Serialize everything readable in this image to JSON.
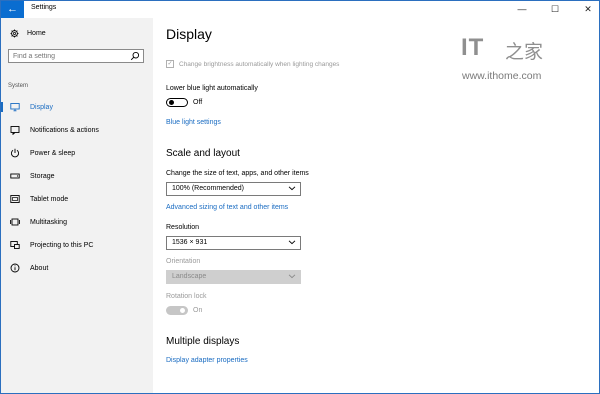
{
  "window": {
    "title": "Settings",
    "back_glyph": "←",
    "minimize_glyph": "—",
    "maximize_glyph": "☐",
    "close_glyph": "✕"
  },
  "sidebar": {
    "home_label": "Home",
    "search_placeholder": "Find a setting",
    "section_label": "System",
    "items": [
      {
        "label": "Display",
        "icon": "monitor-icon",
        "active": true
      },
      {
        "label": "Notifications & actions",
        "icon": "notification-icon",
        "active": false
      },
      {
        "label": "Power & sleep",
        "icon": "power-icon",
        "active": false
      },
      {
        "label": "Storage",
        "icon": "storage-icon",
        "active": false
      },
      {
        "label": "Tablet mode",
        "icon": "tablet-icon",
        "active": false
      },
      {
        "label": "Multitasking",
        "icon": "multitasking-icon",
        "active": false
      },
      {
        "label": "Projecting to this PC",
        "icon": "project-icon",
        "active": false
      },
      {
        "label": "About",
        "icon": "info-icon",
        "active": false
      }
    ]
  },
  "main": {
    "title": "Display",
    "brightness_checkbox": {
      "label": "Change brightness automatically when lighting changes",
      "checked": true,
      "disabled": true
    },
    "blue_light": {
      "label": "Lower blue light automatically",
      "state": "Off",
      "on": false,
      "settings_link": "Blue light settings"
    },
    "scale_layout": {
      "heading": "Scale and layout",
      "size_label": "Change the size of text, apps, and other items",
      "size_value": "100% (Recommended)",
      "advanced_link": "Advanced sizing of text and other items",
      "resolution_label": "Resolution",
      "resolution_value": "1536 × 931",
      "orientation_label": "Orientation",
      "orientation_value": "Landscape",
      "rotation_lock_label": "Rotation lock",
      "rotation_lock_state": "On"
    },
    "multiple_displays": {
      "heading": "Multiple displays",
      "adapter_link": "Display adapter properties"
    }
  },
  "watermark": {
    "logo": "IT",
    "chinese": "之家",
    "url": "www.ithome.com"
  },
  "colors": {
    "accent": "#1a6cc2",
    "titlebar_back": "#0a6dd0",
    "sidebar_bg": "#f2f2f2",
    "disabled": "#9a9a9a"
  }
}
